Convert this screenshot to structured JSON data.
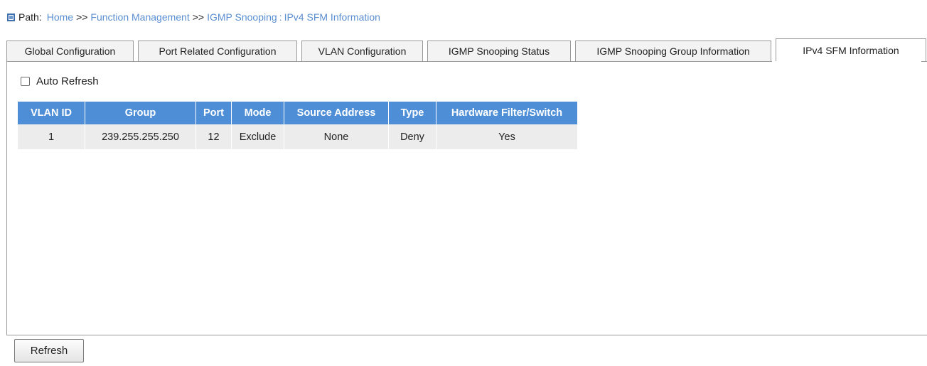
{
  "path": {
    "label": "Path:",
    "crumbs": [
      "Home",
      "Function Management",
      "IGMP Snooping",
      "IPv4 SFM Information"
    ],
    "separator": ">>",
    "colon": ":"
  },
  "tabs": [
    {
      "label": "Global Configuration"
    },
    {
      "label": "Port Related Configuration"
    },
    {
      "label": "VLAN Configuration"
    },
    {
      "label": "IGMP Snooping Status"
    },
    {
      "label": "IGMP Snooping Group Information"
    },
    {
      "label": "IPv4 SFM Information",
      "active": true
    }
  ],
  "auto_refresh": {
    "label": "Auto Refresh",
    "checked": false
  },
  "table": {
    "headers": [
      "VLAN ID",
      "Group",
      "Port",
      "Mode",
      "Source Address",
      "Type",
      "Hardware Filter/Switch"
    ],
    "rows": [
      [
        "1",
        "239.255.255.250",
        "12",
        "Exclude",
        "None",
        "Deny",
        "Yes"
      ]
    ]
  },
  "buttons": {
    "refresh_label": "Refresh"
  },
  "colors": {
    "header_bg": "#4d8ed6",
    "row_bg": "#ececec",
    "link": "#5b8fd1"
  }
}
